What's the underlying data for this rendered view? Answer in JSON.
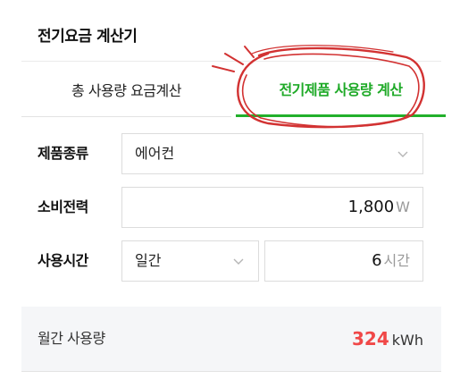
{
  "widget": {
    "title": "전기요금 계산기"
  },
  "tabs": [
    {
      "label": "총 사용량 요금계산",
      "active": false
    },
    {
      "label": "전기제품 사용량 계산",
      "active": true
    }
  ],
  "form": {
    "product_type": {
      "label": "제품종류",
      "selected": "에어컨",
      "icon": "chevron-down-icon"
    },
    "power": {
      "label": "소비전력",
      "value": "1,800",
      "unit": "W"
    },
    "usage_time": {
      "label": "사용시간",
      "period_selected": "일간",
      "hours_value": "6",
      "hours_unit": "시간"
    }
  },
  "result": {
    "label": "월간 사용량",
    "value": "324",
    "unit": "kWh"
  },
  "colors": {
    "active_tab": "#1faa28",
    "result_value": "#f04848",
    "annotation": "#d23232",
    "result_bg": "#f5f6f8"
  }
}
